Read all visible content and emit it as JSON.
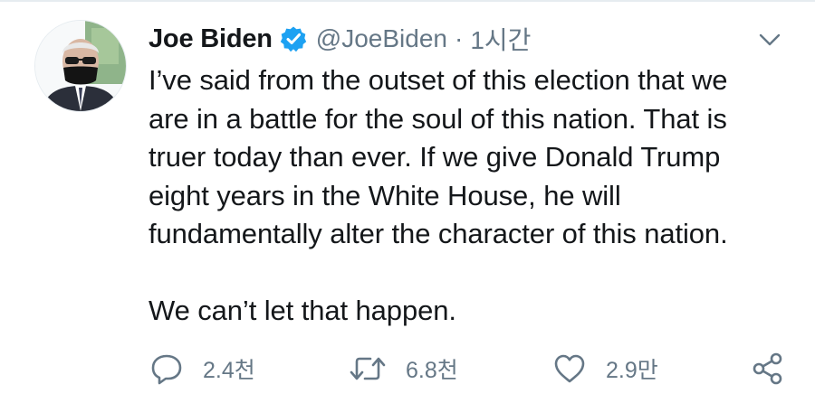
{
  "tweet": {
    "author": {
      "name": "Joe Biden",
      "handle": "@JoeBiden",
      "verified": true,
      "avatar_icon": "profile-photo"
    },
    "separator": "·",
    "time": "1시간",
    "menu_icon": "chevron-down-icon",
    "lines": [
      "I’ve said from the outset of this election that we",
      "are in a battle for the soul of this nation. That is",
      "truer today than ever. If we give Donald Trump",
      "eight years in the White House, he will",
      "fundamentally alter the character of this nation.",
      "",
      "We can’t let that happen."
    ],
    "actions": {
      "reply": {
        "icon": "reply-icon",
        "count": "2.4천"
      },
      "retweet": {
        "icon": "retweet-icon",
        "count": "6.8천"
      },
      "like": {
        "icon": "heart-icon",
        "count": "2.9만"
      },
      "share": {
        "icon": "share-icon"
      }
    }
  },
  "colors": {
    "text": "#14171a",
    "secondary": "#657786",
    "verified_blue": "#1da1f2",
    "border": "#e6ecf0"
  }
}
